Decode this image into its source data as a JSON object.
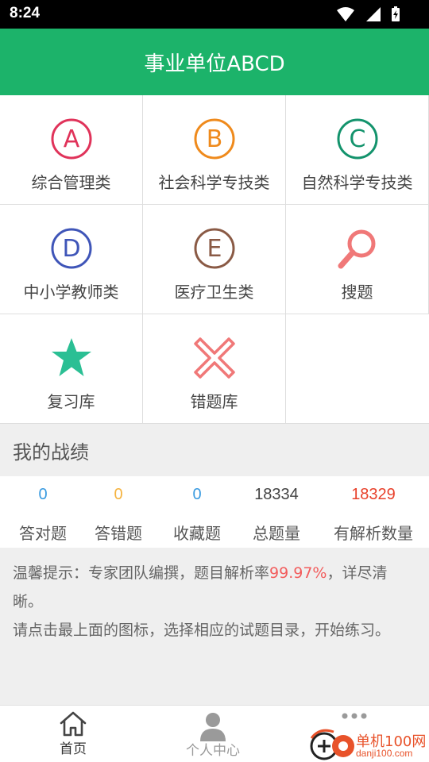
{
  "status_bar": {
    "time": "8:24"
  },
  "header": {
    "title": "事业单位ABCD"
  },
  "categories": [
    {
      "label": "综合管理类",
      "letter": "A",
      "color": "#e0335a",
      "icon": "letter-a-circle-icon"
    },
    {
      "label": "社会科学专技类",
      "letter": "B",
      "color": "#ef8a1c",
      "icon": "letter-b-circle-icon"
    },
    {
      "label": "自然科学专技类",
      "letter": "C",
      "color": "#13936c",
      "icon": "letter-c-circle-icon"
    },
    {
      "label": "中小学教师类",
      "letter": "D",
      "color": "#3f55b8",
      "icon": "letter-d-circle-icon"
    },
    {
      "label": "医疗卫生类",
      "letter": "E",
      "color": "#8a5a45",
      "icon": "letter-e-circle-icon"
    },
    {
      "label": "搜题",
      "color": "#f07878",
      "icon": "search-icon"
    },
    {
      "label": "复习库",
      "color": "#2bbf94",
      "icon": "star-icon"
    },
    {
      "label": "错题库",
      "color": "#f07878",
      "icon": "cross-icon"
    }
  ],
  "stats_section": {
    "title": "我的战绩"
  },
  "stats": [
    {
      "value": "0",
      "label": "答对题",
      "color": "#3a9be0"
    },
    {
      "value": "0",
      "label": "答错题",
      "color": "#f5b340"
    },
    {
      "value": "0",
      "label": "收藏题",
      "color": "#3a9be0"
    },
    {
      "value": "18334",
      "label": "总题量",
      "color": "#444444"
    },
    {
      "value": "18329",
      "label": "有解析数量",
      "color": "#e8402a"
    }
  ],
  "tips": {
    "line1_prefix": "温馨提示：专家团队编撰，题目解析率",
    "line1_highlight": "99.97%",
    "line1_suffix": "，详尽清晰。",
    "line2": "请点击最上面的图标，选择相应的试题目录，开始练习。"
  },
  "bottom_nav": [
    {
      "label": "首页",
      "icon": "home-icon",
      "active": true
    },
    {
      "label": "个人中心",
      "icon": "person-icon",
      "active": false
    },
    {
      "label": "",
      "icon": "more-icon",
      "active": false
    }
  ],
  "watermark": {
    "text": "单机100网",
    "url": "danji100.com"
  },
  "colors": {
    "brand_green": "#1cb36a",
    "highlight_red": "#f25c5c"
  }
}
